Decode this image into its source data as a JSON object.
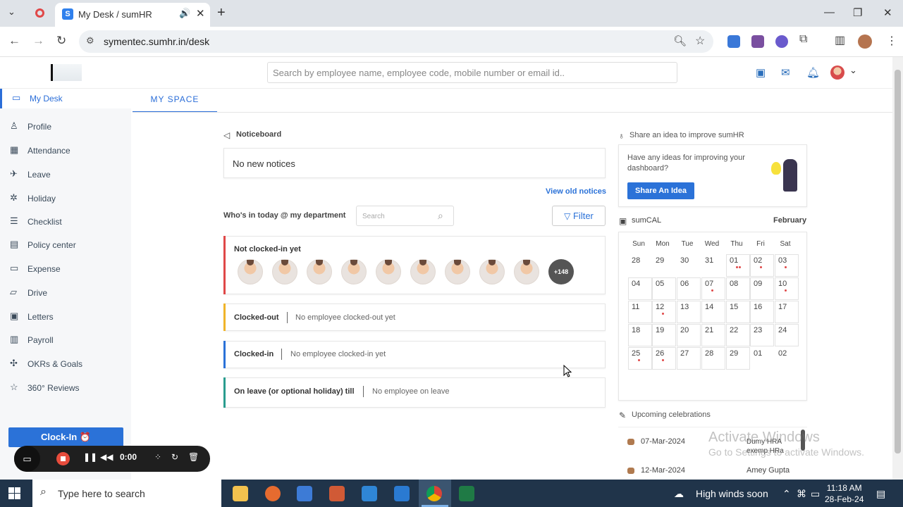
{
  "browser": {
    "tab_title": "My Desk / sumHR",
    "tab_favicon_letter": "S",
    "url": "symentec.sumhr.in/desk"
  },
  "header": {
    "search_placeholder": "Search by employee name, employee code, mobile number or email id.."
  },
  "sidebar": {
    "items": [
      {
        "label": "My Desk",
        "icon": "monitor-icon",
        "glyph": "▭"
      },
      {
        "label": "Profile",
        "icon": "person-icon",
        "glyph": "♙"
      },
      {
        "label": "Attendance",
        "icon": "calendar-icon",
        "glyph": "▦"
      },
      {
        "label": "Leave",
        "icon": "plane-icon",
        "glyph": "✈"
      },
      {
        "label": "Holiday",
        "icon": "palm-icon",
        "glyph": "✲"
      },
      {
        "label": "Checklist",
        "icon": "checklist-icon",
        "glyph": "☰"
      },
      {
        "label": "Policy center",
        "icon": "document-icon",
        "glyph": "▤"
      },
      {
        "label": "Expense",
        "icon": "expense-icon",
        "glyph": "▭"
      },
      {
        "label": "Drive",
        "icon": "folder-icon",
        "glyph": "▱"
      },
      {
        "label": "Letters",
        "icon": "letter-icon",
        "glyph": "▣"
      },
      {
        "label": "Payroll",
        "icon": "payroll-icon",
        "glyph": "▥"
      },
      {
        "label": "OKRs & Goals",
        "icon": "goals-icon",
        "glyph": "✣"
      },
      {
        "label": "360° Reviews",
        "icon": "star-icon",
        "glyph": "☆"
      }
    ],
    "clock_in_label": "Clock-In ⏰"
  },
  "main": {
    "tab_label": "MY SPACE",
    "noticeboard_title": "Noticeboard",
    "notice_text": "No new notices",
    "view_old_notices": "View old notices",
    "whos_in_title": "Who's in today @ my department",
    "dept_search_placeholder": "Search",
    "filter_label": "Filter",
    "not_clocked_in_title": "Not clocked-in yet",
    "more_count": "+148",
    "statuses": [
      {
        "label": "Clocked-out",
        "value": "No employee clocked-out yet",
        "color": "#f0b429"
      },
      {
        "label": "Clocked-in",
        "value": "No employee clocked-in yet",
        "color": "#2b72d8"
      },
      {
        "label": "On leave (or optional holiday) till",
        "value": "No employee on leave",
        "color": "#2a9d8f"
      }
    ],
    "not_clocked_color": "#e04848"
  },
  "right": {
    "idea_title": "Share an idea to improve sumHR",
    "idea_text": "Have any ideas for improving your dashboard?",
    "idea_button": "Share An Idea",
    "cal_title": "sumCAL",
    "cal_month": "February",
    "weekdays": [
      "Sun",
      "Mon",
      "Tue",
      "Wed",
      "Thu",
      "Fri",
      "Sat"
    ],
    "weeks": [
      [
        {
          "d": "28",
          "box": false,
          "dots": 0
        },
        {
          "d": "29",
          "box": false,
          "dots": 0
        },
        {
          "d": "30",
          "box": false,
          "dots": 0
        },
        {
          "d": "31",
          "box": false,
          "dots": 0
        },
        {
          "d": "01",
          "box": true,
          "dots": 2
        },
        {
          "d": "02",
          "box": true,
          "dots": 1
        },
        {
          "d": "03",
          "box": true,
          "dots": 1
        }
      ],
      [
        {
          "d": "04",
          "box": true,
          "dots": 0
        },
        {
          "d": "05",
          "box": true,
          "dots": 0
        },
        {
          "d": "06",
          "box": true,
          "dots": 0
        },
        {
          "d": "07",
          "box": true,
          "dots": 1
        },
        {
          "d": "08",
          "box": true,
          "dots": 0
        },
        {
          "d": "09",
          "box": true,
          "dots": 0
        },
        {
          "d": "10",
          "box": true,
          "dots": 1
        }
      ],
      [
        {
          "d": "11",
          "box": true,
          "dots": 0
        },
        {
          "d": "12",
          "box": true,
          "dots": 1
        },
        {
          "d": "13",
          "box": true,
          "dots": 0
        },
        {
          "d": "14",
          "box": true,
          "dots": 0
        },
        {
          "d": "15",
          "box": true,
          "dots": 0
        },
        {
          "d": "16",
          "box": true,
          "dots": 0
        },
        {
          "d": "17",
          "box": true,
          "dots": 0
        }
      ],
      [
        {
          "d": "18",
          "box": true,
          "dots": 0
        },
        {
          "d": "19",
          "box": true,
          "dots": 0
        },
        {
          "d": "20",
          "box": true,
          "dots": 0
        },
        {
          "d": "21",
          "box": true,
          "dots": 0
        },
        {
          "d": "22",
          "box": true,
          "dots": 0
        },
        {
          "d": "23",
          "box": true,
          "dots": 0
        },
        {
          "d": "24",
          "box": true,
          "dots": 0
        }
      ],
      [
        {
          "d": "25",
          "box": true,
          "dots": 1
        },
        {
          "d": "26",
          "box": true,
          "dots": 1
        },
        {
          "d": "27",
          "box": true,
          "dots": 0
        },
        {
          "d": "28",
          "box": true,
          "dots": 0
        },
        {
          "d": "29",
          "box": true,
          "dots": 0
        },
        {
          "d": "01",
          "box": false,
          "dots": 0
        },
        {
          "d": "02",
          "box": false,
          "dots": 0
        }
      ]
    ],
    "celebrations_title": "Upcoming celebrations",
    "celebrations": [
      {
        "date": "07-Mar-2024",
        "name": "Dumy HRA exemp HRa"
      },
      {
        "date": "12-Mar-2024",
        "name": "Amey Gupta"
      }
    ]
  },
  "recorder": {
    "time": "0:00"
  },
  "watermark": {
    "line1": "Activate Windows",
    "line2": "Go to Settings to activate Windows."
  },
  "taskbar": {
    "search_placeholder": "Type here to search",
    "weather": "High winds soon",
    "time": "11:18 AM",
    "date": "28-Feb-24"
  }
}
